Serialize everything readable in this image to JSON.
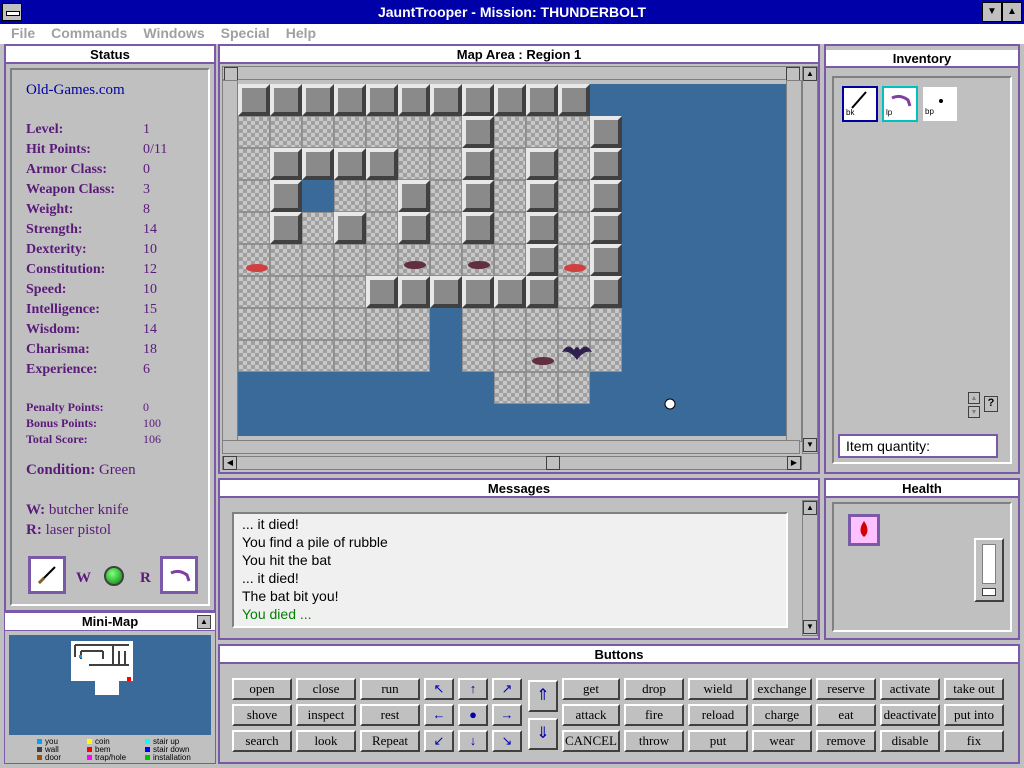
{
  "window": {
    "title": "JauntTrooper - Mission: THUNDERBOLT"
  },
  "menu": [
    "File",
    "Commands",
    "Windows",
    "Special",
    "Help"
  ],
  "status": {
    "title": "Status",
    "site": "Old-Games.com",
    "stats": [
      {
        "label": "Level:",
        "value": "1"
      },
      {
        "label": "Hit Points:",
        "value": "0/11"
      },
      {
        "label": "Armor Class:",
        "value": "0"
      },
      {
        "label": "Weapon Class:",
        "value": "3"
      },
      {
        "label": "Weight:",
        "value": "8"
      },
      {
        "label": "Strength:",
        "value": "14"
      },
      {
        "label": "Dexterity:",
        "value": "10"
      },
      {
        "label": "Constitution:",
        "value": "12"
      },
      {
        "label": "Speed:",
        "value": "10"
      },
      {
        "label": "Intelligence:",
        "value": "15"
      },
      {
        "label": "Wisdom:",
        "value": "14"
      },
      {
        "label": "Charisma:",
        "value": "18"
      },
      {
        "label": "Experience:",
        "value": "6"
      }
    ],
    "points": [
      {
        "label": "Penalty Points:",
        "value": "0"
      },
      {
        "label": "Bonus Points:",
        "value": "100"
      },
      {
        "label": "Total Score:",
        "value": "106"
      }
    ],
    "condition_label": "Condition:",
    "condition_value": "Green",
    "weapon_w_label": "W:",
    "weapon_w": "butcher knife",
    "weapon_r_label": "R:",
    "weapon_r": "laser pistol",
    "slot_w_label": "W",
    "slot_r_label": "R"
  },
  "minimap": {
    "title": "Mini-Map",
    "legend": [
      {
        "label": "you",
        "color": "#00a0ff"
      },
      {
        "label": "coin",
        "color": "#ffff00"
      },
      {
        "label": "stair up",
        "color": "#00ffff"
      },
      {
        "label": "wall",
        "color": "#404040"
      },
      {
        "label": "bem",
        "color": "#ff0000"
      },
      {
        "label": "stair down",
        "color": "#0000ff"
      },
      {
        "label": "door",
        "color": "#a05000"
      },
      {
        "label": "trap/hole",
        "color": "#ff00ff"
      },
      {
        "label": "installation",
        "color": "#00c000"
      }
    ]
  },
  "map": {
    "title": "Map Area : Region 1"
  },
  "inventory": {
    "title": "Inventory",
    "items": [
      "bk",
      "lp",
      "bp"
    ],
    "quantity_label": "Item quantity:",
    "help": "?"
  },
  "messages": {
    "title": "Messages",
    "lines": [
      "... it died!",
      "You find a pile of rubble",
      "You hit the bat",
      "... it died!",
      "The bat bit you!",
      "You died ..."
    ],
    "last_color": "#008000"
  },
  "health": {
    "title": "Health"
  },
  "buttons": {
    "title": "Buttons",
    "col1": [
      "open",
      "shove",
      "search"
    ],
    "col2": [
      "close",
      "inspect",
      "look"
    ],
    "col3": [
      "run",
      "rest",
      "Repeat"
    ],
    "col4": [
      "get",
      "attack",
      "CANCEL"
    ],
    "col5": [
      "drop",
      "fire",
      "throw"
    ],
    "col6": [
      "wield",
      "reload",
      "put"
    ],
    "col7": [
      "exchange",
      "charge",
      "wear"
    ],
    "col8": [
      "reserve",
      "eat",
      "remove"
    ],
    "col9": [
      "activate",
      "deactivate",
      "disable"
    ],
    "col10": [
      "take out",
      "put into",
      "fix"
    ],
    "arrows": [
      "↖",
      "↑",
      "↗",
      "←",
      "●",
      "→",
      "↙",
      "↓",
      "↘"
    ],
    "stairs": [
      "⇑",
      "⇓"
    ]
  }
}
